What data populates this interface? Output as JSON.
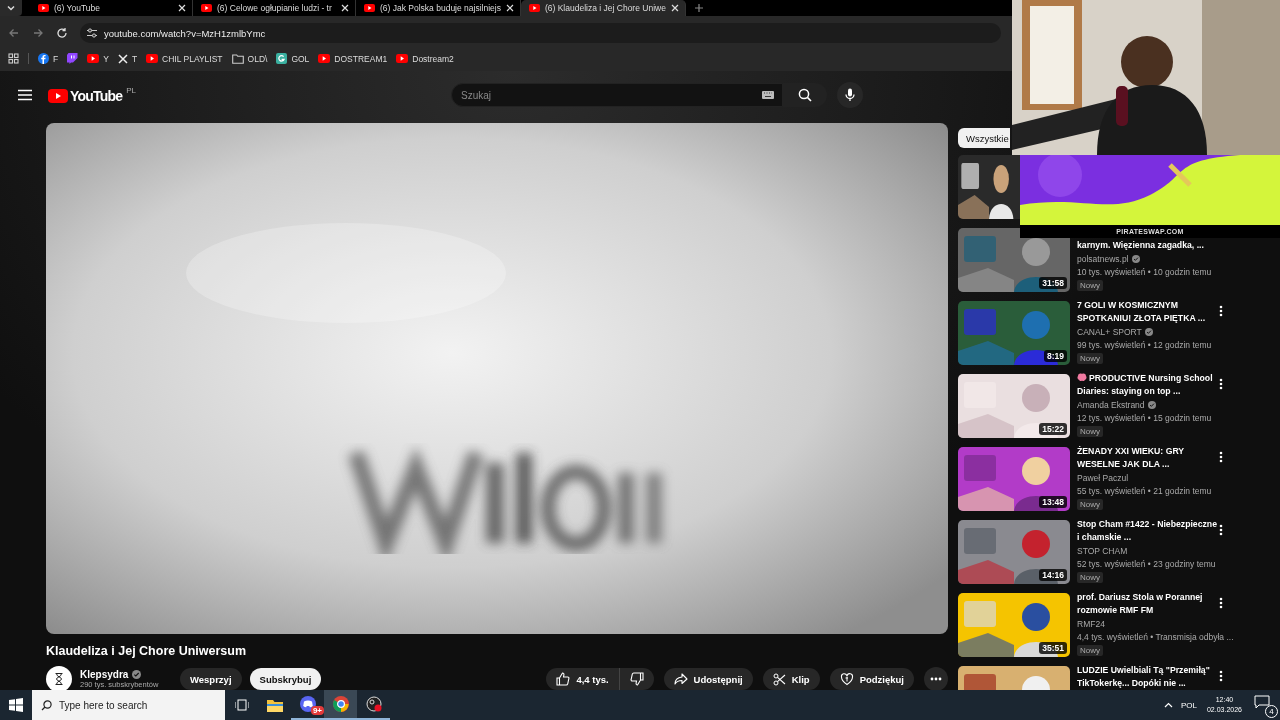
{
  "browser": {
    "tabs": [
      {
        "title": "(6) YouTube",
        "selected": false
      },
      {
        "title": "(6) Celowe ogłupianie ludzi - tr",
        "selected": false
      },
      {
        "title": "(6) Jak Polska buduje najsilniejs",
        "selected": false
      },
      {
        "title": "(6) Klaudeliza i Jej Chore Uniwe",
        "selected": true
      }
    ],
    "url": "youtube.com/watch?v=MzH1zmlbYmc",
    "bookmarks": [
      {
        "kind": "round",
        "label": "F"
      },
      {
        "kind": "chat"
      },
      {
        "kind": "play",
        "label": "Y"
      },
      {
        "kind": "cross",
        "label": "T"
      },
      {
        "kind": "play",
        "label": "CHIL PLAYLIST"
      },
      {
        "kind": "folder",
        "label": "OLD\\"
      },
      {
        "kind": "tile",
        "label": "GOL"
      },
      {
        "kind": "play",
        "label": "DOSTREAM1"
      },
      {
        "kind": "play",
        "label": "Dostream2"
      }
    ]
  },
  "header": {
    "logo": "YouTube",
    "region": "PL",
    "search": {
      "placeholder": "Szukaj"
    }
  },
  "video": {
    "title": "Klaudeliza i Jej Chore Uniwersum",
    "channel": {
      "name": "Klepsydra",
      "verified": true,
      "subscribers": "290 tys. subskrybentów"
    },
    "buttons": [
      {
        "label": "Wesprzyj",
        "kind": "plain"
      },
      {
        "label": "Subskrybuj",
        "kind": "primary"
      }
    ],
    "likes": "4,4 tys.",
    "actions": [
      {
        "kind": "share",
        "label": "Udostępnij"
      },
      {
        "kind": "clip",
        "label": "Klip"
      },
      {
        "kind": "thanks",
        "label": "Podziękuj"
      },
      {
        "kind": "more"
      }
    ]
  },
  "sidebar": {
    "chips": [
      {
        "label": "Wszystkie",
        "selected": true
      }
    ],
    "videos": [
      {
        "kind": "picture"
      },
      {
        "kind": "covered",
        "title": "karnym. Więzienna zagadka, ...",
        "channel": "polsatnews.pl",
        "verified": true,
        "meta": "10 tys. wyświetleń • 10 godzin temu",
        "badge": "Nowy",
        "duration": "31:58"
      },
      {
        "kind": "video",
        "title": "7 GOLI W KOSMICZNYM SPOTKANIU! ZŁOTA PIĘTKA ...",
        "channel": "CANAL+ SPORT",
        "verified": true,
        "meta": "99 tys. wyświetleń • 12 godzin temu",
        "badge": "Nowy",
        "duration": "8:19",
        "menu": true
      },
      {
        "kind": "video",
        "emoji": true,
        "title": "PRODUCTIVE Nursing School Diaries: staying on top ...",
        "channel": "Amanda Ekstrand",
        "verified": true,
        "meta": "12 tys. wyświetleń • 15 godzin temu",
        "badge": "Nowy",
        "duration": "15:22",
        "menu": true
      },
      {
        "kind": "video",
        "title": "ŻENADY XXI WIEKU: GRY WESELNE JAK DLA ...",
        "channel": "Paweł Paczul",
        "meta": "55 tys. wyświetleń • 21 godzin temu",
        "badge": "Nowy",
        "duration": "13:48",
        "menu": true
      },
      {
        "kind": "video",
        "title": "Stop Cham #1422 - Niebezpieczne i chamskie ...",
        "channel": "STOP CHAM",
        "meta": "52 tys. wyświetleń • 23 godziny temu",
        "badge": "Nowy",
        "duration": "14:16",
        "menu": true
      },
      {
        "kind": "video",
        "title": "prof. Dariusz Stola w Porannej rozmowie RMF FM",
        "channel": "RMF24",
        "meta": "4,4 tys. wyświetleń • Transmisja odbyła ...",
        "badge": "Nowy",
        "duration": "35:51",
        "menu": true
      },
      {
        "kind": "video",
        "title": "LUDZIE Uwielbiali Tą \"Przemiłą\" TikTokerkę... Dopóki nie ...",
        "menu": true
      }
    ]
  },
  "overlay": {
    "banner": "PIRATESWAP.COM"
  },
  "taskbar": {
    "search": {
      "placeholder": "Type here to search"
    },
    "apps": [
      {
        "kind": "taskview",
        "running": false,
        "selected": false
      },
      {
        "kind": "files",
        "running": false,
        "selected": false
      },
      {
        "kind": "chat",
        "badge": "9+",
        "running": true,
        "selected": false
      },
      {
        "kind": "browser",
        "running": true,
        "selected": true
      },
      {
        "kind": "recorder",
        "running": true,
        "selected": false
      }
    ],
    "language": "POL",
    "time": "12:40",
    "date": "02.03.2026",
    "notifications": "4"
  }
}
